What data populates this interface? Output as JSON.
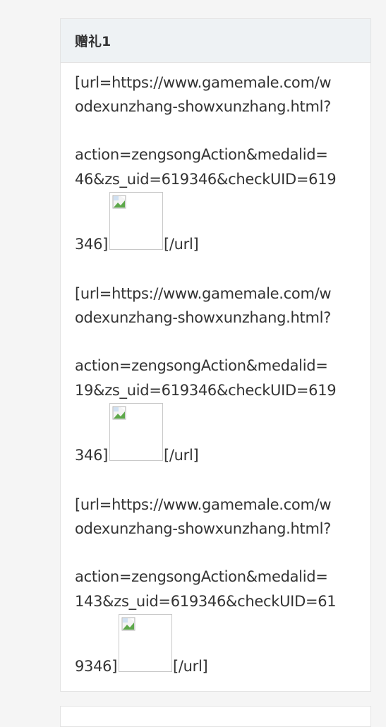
{
  "panel": {
    "title": "赠礼1",
    "entries": [
      {
        "line1": "[url=https://www.gamemale.com/w",
        "line2": "odexunzhang-showxunzhang.html?",
        "line3": "action=zengsongAction&medalid=",
        "line4": "46&zs_uid=619346&checkUID=619",
        "line5_prefix": "346]",
        "line5_suffix": "[/url]"
      },
      {
        "line1": "[url=https://www.gamemale.com/w",
        "line2": "odexunzhang-showxunzhang.html?",
        "line3": "action=zengsongAction&medalid=",
        "line4": "19&zs_uid=619346&checkUID=619",
        "line5_prefix": "346]",
        "line5_suffix": "[/url]"
      },
      {
        "line1": "[url=https://www.gamemale.com/w",
        "line2": "odexunzhang-showxunzhang.html?",
        "line3": "action=zengsongAction&medalid=",
        "line4": "143&zs_uid=619346&checkUID=61",
        "line5_prefix": "9346]",
        "line5_suffix": "[/url]"
      }
    ]
  },
  "icons": {
    "broken_image": "broken-image-icon"
  }
}
